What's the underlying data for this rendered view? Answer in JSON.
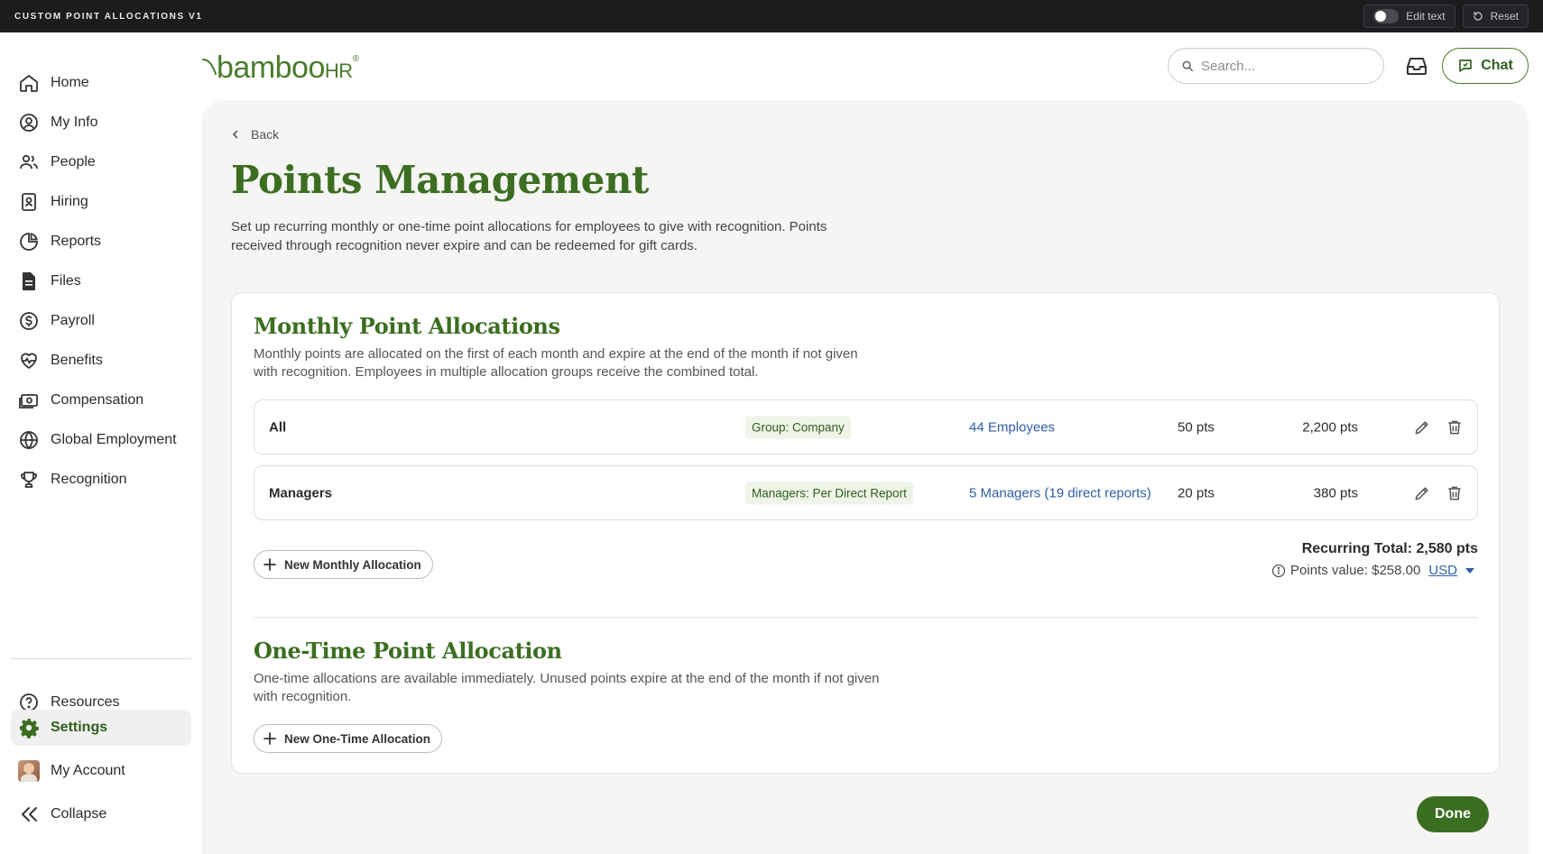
{
  "topbar": {
    "title": "CUSTOM POINT ALLOCATIONS V1",
    "edit_text": "Edit text",
    "reset": "Reset"
  },
  "sidebar": {
    "items": [
      {
        "label": "Home",
        "icon": "home-icon"
      },
      {
        "label": "My Info",
        "icon": "user-circle-icon"
      },
      {
        "label": "People",
        "icon": "people-icon"
      },
      {
        "label": "Hiring",
        "icon": "badge-icon"
      },
      {
        "label": "Reports",
        "icon": "pie-chart-icon"
      },
      {
        "label": "Files",
        "icon": "file-icon"
      },
      {
        "label": "Payroll",
        "icon": "dollar-circle-icon"
      },
      {
        "label": "Benefits",
        "icon": "heart-pulse-icon"
      },
      {
        "label": "Compensation",
        "icon": "money-icon"
      },
      {
        "label": "Global Employment",
        "icon": "globe-icon"
      },
      {
        "label": "Recognition",
        "icon": "trophy-icon"
      }
    ],
    "bottom": {
      "resources": "Resources",
      "settings": "Settings",
      "my_account": "My Account",
      "collapse": "Collapse"
    }
  },
  "header": {
    "logo_text": "bamboo",
    "logo_hr": "HR",
    "search_placeholder": "Search...",
    "chat_label": "Chat"
  },
  "main": {
    "back_label": "Back",
    "title": "Points Management",
    "description": "Set up recurring monthly or one-time point allocations for employees to give with recognition. Points received through recognition never expire and can be redeemed for gift cards.",
    "monthly": {
      "title": "Monthly Point Allocations",
      "description": "Monthly points are allocated on the first of each month and expire at the end of the month if not given with recognition. Employees in multiple allocation groups receive the combined total.",
      "rows": [
        {
          "name": "All",
          "group": "Group: Company",
          "employees": "44 Employees",
          "per": "50 pts",
          "total": "2,200 pts"
        },
        {
          "name": "Managers",
          "group": "Managers: Per Direct Report",
          "employees": "5 Managers (19 direct reports)",
          "per": "20 pts",
          "total": "380 pts"
        }
      ],
      "new_button": "New Monthly Allocation",
      "recurring_total": "Recurring Total: 2,580 pts",
      "points_value": "Points value: $258.00",
      "currency": "USD"
    },
    "one_time": {
      "title": "One-Time Point Allocation",
      "description": "One-time allocations are available immediately. Unused points expire at the end of the month if not given with recognition.",
      "new_button": "New One-Time Allocation"
    },
    "done_label": "Done"
  },
  "colors": {
    "brand_green": "#3c6e21",
    "link_blue": "#2f5ea8",
    "topbar_bg": "#1b1c1e",
    "panel_bg": "#f5f5f3"
  }
}
